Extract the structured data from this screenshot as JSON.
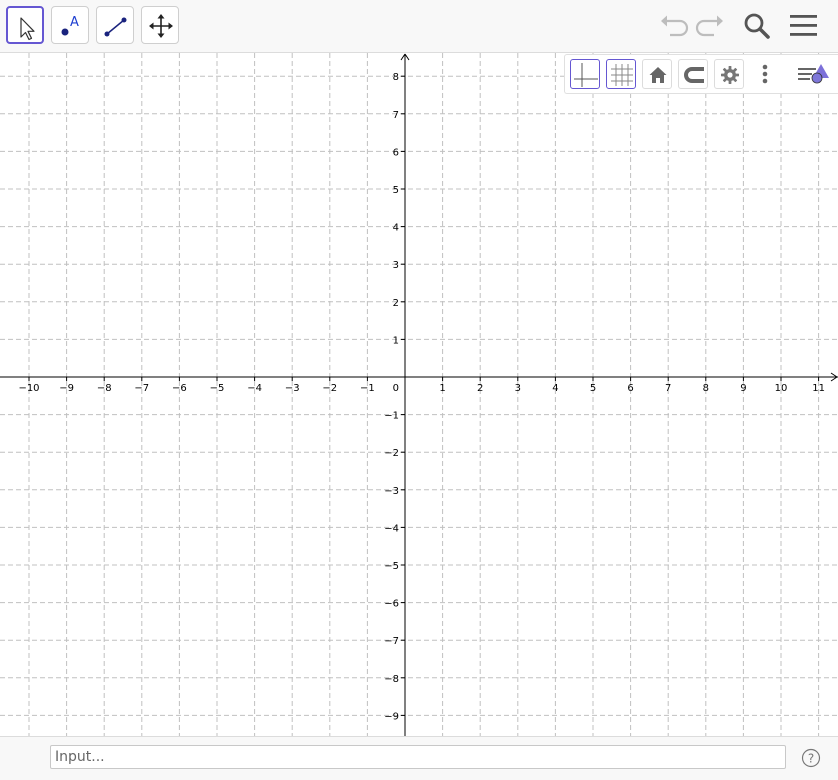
{
  "toolbar": {
    "tools": [
      {
        "name": "Move",
        "icon": "pointer-arrow-icon",
        "active": true
      },
      {
        "name": "Point",
        "icon": "point-icon",
        "label": "A"
      },
      {
        "name": "Segment",
        "icon": "segment-icon"
      },
      {
        "name": "Move Graphics View",
        "icon": "move-graphics-icon"
      }
    ],
    "right_icons": [
      "undo-icon",
      "redo-icon",
      "search-icon",
      "menu-icon"
    ]
  },
  "style_bar": {
    "buttons": [
      "axes-toggle-icon",
      "grid-toggle-icon",
      "home-icon",
      "magnet-icon",
      "gear-icon",
      "more-vertical-icon",
      "style-bar-toggle-icon"
    ],
    "selected": [
      "axes",
      "grid"
    ]
  },
  "graph": {
    "x_range": [
      -10.5,
      11.2
    ],
    "y_range": [
      -9.5,
      8.5
    ],
    "x_ticks": [
      "−10",
      "−9",
      "−8",
      "−7",
      "−6",
      "−5",
      "−4",
      "−3",
      "−2",
      "−1",
      "1",
      "2",
      "3",
      "4",
      "5",
      "6",
      "7",
      "8",
      "9",
      "10",
      "11"
    ],
    "y_ticks_positive": [
      "1",
      "2",
      "3",
      "4",
      "5",
      "6",
      "7",
      "8"
    ],
    "y_ticks_negative": [
      "−1",
      "−2",
      "−3",
      "−4",
      "−5",
      "−6",
      "−7",
      "−8",
      "−9"
    ],
    "origin_label": "0",
    "grid": true,
    "grid_style": "dashed",
    "colors": {
      "grid": "#c0c0c0",
      "axis": "#000000",
      "accent": "#6557d2",
      "point": "#1a237e"
    }
  },
  "input_bar": {
    "placeholder": "Input..."
  },
  "help_label": "?"
}
